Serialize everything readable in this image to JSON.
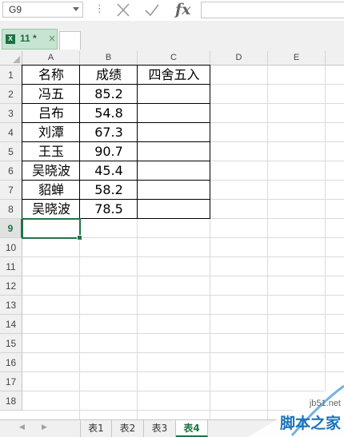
{
  "formula_bar": {
    "name_box": "G9",
    "formula": "",
    "fx_label": "fx"
  },
  "document_tab": {
    "name": "11 *",
    "close": "×"
  },
  "grid": {
    "columns": [
      "A",
      "B",
      "C",
      "D",
      "E"
    ],
    "rows": [
      "1",
      "2",
      "3",
      "4",
      "5",
      "6",
      "7",
      "8",
      "9",
      "10",
      "11",
      "12",
      "13",
      "14",
      "15",
      "16",
      "17",
      "18"
    ],
    "header": [
      "名称",
      "成绩",
      "四舍五入"
    ],
    "data": [
      {
        "name": "冯五",
        "score": "85.2",
        "rounded": ""
      },
      {
        "name": "吕布",
        "score": "54.8",
        "rounded": ""
      },
      {
        "name": "刘潭",
        "score": "67.3",
        "rounded": ""
      },
      {
        "name": "王玉",
        "score": "90.7",
        "rounded": ""
      },
      {
        "name": "吴晓波",
        "score": "45.4",
        "rounded": ""
      },
      {
        "name": "貂蝉",
        "score": "58.2",
        "rounded": ""
      },
      {
        "name": "吴晓波",
        "score": "78.5",
        "rounded": ""
      }
    ],
    "selected_row": "9"
  },
  "sheets": {
    "tabs": [
      "表1",
      "表2",
      "表3",
      "表4"
    ],
    "active": "表4"
  },
  "watermark": {
    "site": "jb51.net",
    "brand": "脚本之家"
  }
}
